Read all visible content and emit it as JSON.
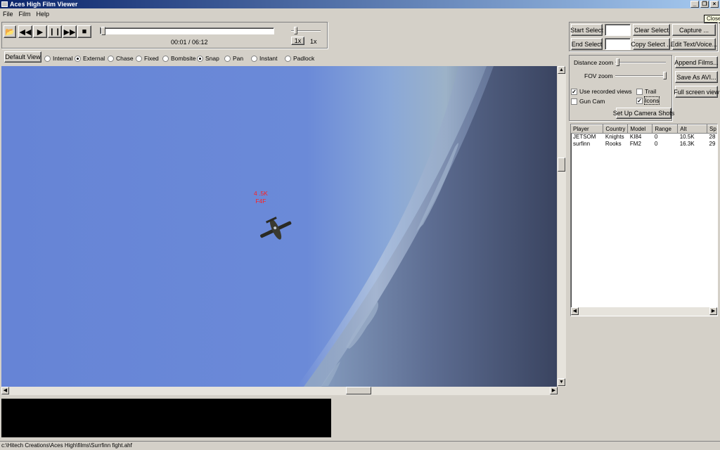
{
  "window": {
    "title": "Aces High Film Viewer",
    "tooltip": "Close"
  },
  "menu": [
    "File",
    "Film",
    "Help"
  ],
  "transport": {
    "open_icon": "folder-open-icon",
    "icons": [
      "rewind-icon",
      "play-icon",
      "pause-icon",
      "fast-forward-icon",
      "stop-icon"
    ],
    "time": "00:01 / 06:12",
    "speed_btn": "1x",
    "speed_label": "1x",
    "progress": 0.003
  },
  "views": {
    "default_view": "Default View",
    "options": [
      {
        "label": "Internal",
        "checked": false
      },
      {
        "label": "External",
        "checked": true
      },
      {
        "label": "Chase",
        "checked": false
      },
      {
        "label": "Fixed",
        "checked": false
      },
      {
        "label": "Bombsite",
        "checked": false
      },
      {
        "label": "Snap",
        "checked": true
      },
      {
        "label": "Pan",
        "checked": false
      },
      {
        "label": "Instant",
        "checked": false
      },
      {
        "label": "Padlock",
        "checked": false
      }
    ]
  },
  "select": {
    "start": "Start Select",
    "end": "End Select",
    "clear": "Clear Select",
    "copy": "Copy Select ...",
    "capture": "Capture ...",
    "edit": "Edit Text/Voice..."
  },
  "camera": {
    "distance_zoom": "Distance zoom",
    "fov_zoom": "FOV zoom",
    "append": "Append Films...",
    "save_avi": "Save As AVI...",
    "full_screen": "Full screen view",
    "use_recorded": "Use recorded views",
    "use_recorded_checked": true,
    "trail": "Trail",
    "trail_checked": false,
    "gun_cam": "Gun Cam",
    "gun_cam_checked": false,
    "icons": "Icons",
    "icons_checked": true,
    "setup_shots": "Set Up Camera Shots"
  },
  "players": {
    "columns": [
      "Player",
      "Country",
      "Model",
      "Range",
      "Alt",
      "Sp"
    ],
    "rows": [
      [
        "JETSOM",
        "Knights",
        "KI84",
        "0",
        "10.5K",
        "28"
      ],
      [
        "surfinn",
        "Rooks",
        "FM2",
        "0",
        "16.3K",
        "29"
      ]
    ]
  },
  "scene": {
    "label_line1": "4 .5K",
    "label_line2": "F4F"
  },
  "status": {
    "path": "c:\\Hitech Creations\\Aces High\\films\\Surrfinn fight.ahf"
  },
  "colors": {
    "sky": "#6684d6",
    "titlebar": "#0a246a",
    "icon_label": "#ff2020"
  }
}
